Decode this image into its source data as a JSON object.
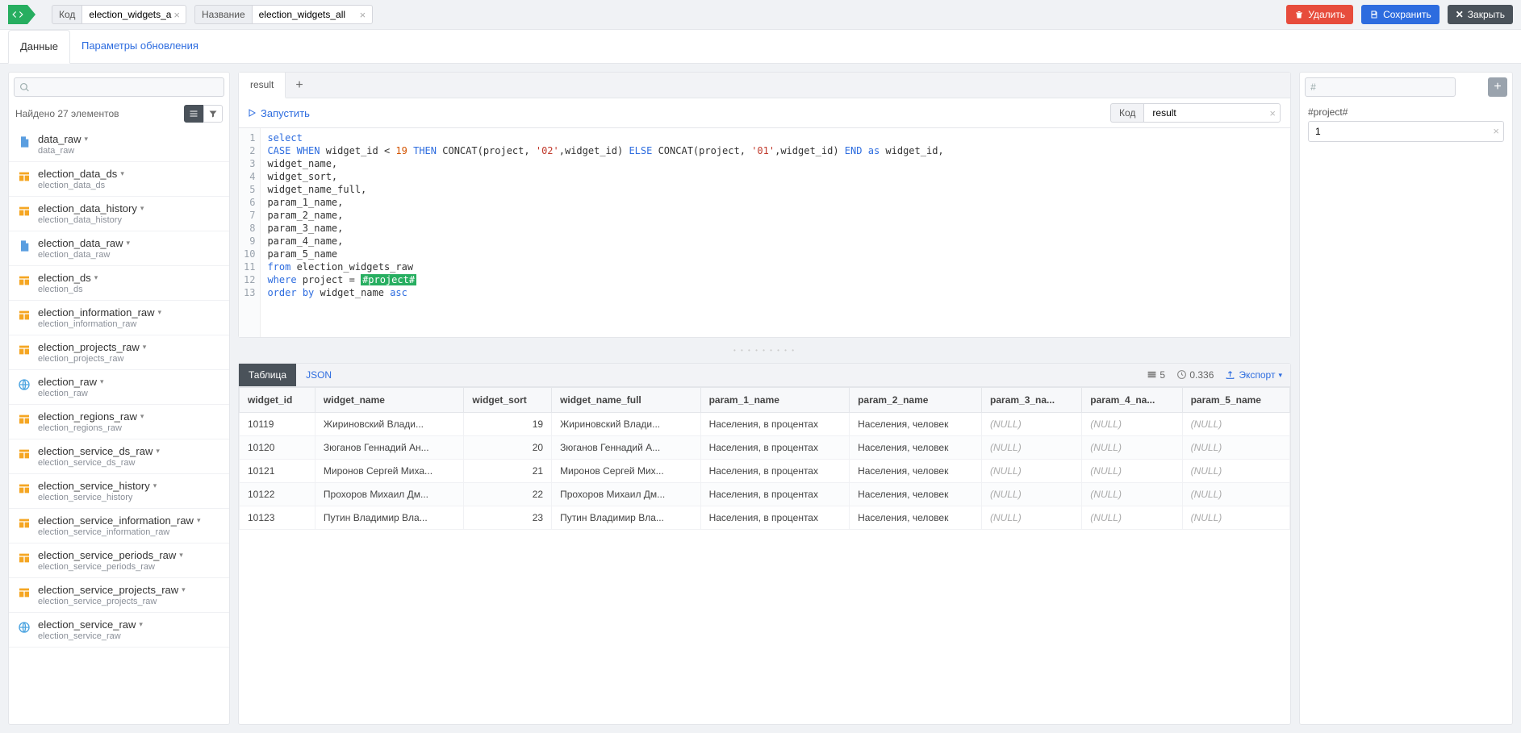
{
  "topbar": {
    "code_label": "Код",
    "code_value": "election_widgets_a",
    "name_label": "Название",
    "name_value": "election_widgets_all",
    "delete_btn": "Удалить",
    "save_btn": "Сохранить",
    "close_btn": "Закрыть"
  },
  "main_tabs": {
    "data": "Данные",
    "params": "Параметры обновления"
  },
  "sidebar": {
    "found_text": "Найдено 27 элементов",
    "items": [
      {
        "title": "data_raw",
        "sub": "data_raw",
        "icon": "doc"
      },
      {
        "title": "election_data_ds",
        "sub": "election_data_ds",
        "icon": "table"
      },
      {
        "title": "election_data_history",
        "sub": "election_data_history",
        "icon": "table"
      },
      {
        "title": "election_data_raw",
        "sub": "election_data_raw",
        "icon": "doc"
      },
      {
        "title": "election_ds",
        "sub": "election_ds",
        "icon": "table"
      },
      {
        "title": "election_information_raw",
        "sub": "election_information_raw",
        "icon": "table"
      },
      {
        "title": "election_projects_raw",
        "sub": "election_projects_raw",
        "icon": "table"
      },
      {
        "title": "election_raw",
        "sub": "election_raw",
        "icon": "globe"
      },
      {
        "title": "election_regions_raw",
        "sub": "election_regions_raw",
        "icon": "table"
      },
      {
        "title": "election_service_ds_raw",
        "sub": "election_service_ds_raw",
        "icon": "table"
      },
      {
        "title": "election_service_history",
        "sub": "election_service_history",
        "icon": "table"
      },
      {
        "title": "election_service_information_raw",
        "sub": "election_service_information_raw",
        "icon": "table"
      },
      {
        "title": "election_service_periods_raw",
        "sub": "election_service_periods_raw",
        "icon": "table"
      },
      {
        "title": "election_service_projects_raw",
        "sub": "election_service_projects_raw",
        "icon": "table"
      },
      {
        "title": "election_service_raw",
        "sub": "election_service_raw",
        "icon": "globe"
      }
    ]
  },
  "code": {
    "tab": "result",
    "run": "Запустить",
    "kod_label": "Код",
    "kod_value": "result",
    "lines": [
      "select",
      "CASE WHEN widget_id < 19 THEN CONCAT(project, '02',widget_id) ELSE CONCAT(project, '01',widget_id) END as widget_id,",
      "widget_name,",
      "widget_sort,",
      "widget_name_full,",
      "param_1_name,",
      "param_2_name,",
      "param_3_name,",
      "param_4_name,",
      "param_5_name",
      "from election_widgets_raw",
      "where project = #project#",
      "order by widget_name asc"
    ]
  },
  "result": {
    "tab_table": "Таблица",
    "tab_json": "JSON",
    "count": "5",
    "time": "0.336",
    "export": "Экспорт",
    "columns": [
      "widget_id",
      "widget_name",
      "widget_sort",
      "widget_name_full",
      "param_1_name",
      "param_2_name",
      "param_3_na...",
      "param_4_na...",
      "param_5_name"
    ],
    "rows": [
      [
        "10119",
        "Жириновский Влади...",
        "19",
        "Жириновский Влади...",
        "Населения, в процентах",
        "Населения, человек",
        "(NULL)",
        "(NULL)",
        "(NULL)"
      ],
      [
        "10120",
        "Зюганов Геннадий Ан...",
        "20",
        "Зюганов Геннадий А...",
        "Населения, в процентах",
        "Населения, человек",
        "(NULL)",
        "(NULL)",
        "(NULL)"
      ],
      [
        "10121",
        "Миронов Сергей Миха...",
        "21",
        "Миронов Сергей Мих...",
        "Населения, в процентах",
        "Населения, человек",
        "(NULL)",
        "(NULL)",
        "(NULL)"
      ],
      [
        "10122",
        "Прохоров Михаил Дм...",
        "22",
        "Прохоров Михаил Дм...",
        "Населения, в процентах",
        "Населения, человек",
        "(NULL)",
        "(NULL)",
        "(NULL)"
      ],
      [
        "10123",
        "Путин Владимир Вла...",
        "23",
        "Путин Владимир Вла...",
        "Населения, в процентах",
        "Населения, человек",
        "(NULL)",
        "(NULL)",
        "(NULL)"
      ]
    ]
  },
  "right": {
    "param_label": "#project#",
    "param_value": "1"
  }
}
